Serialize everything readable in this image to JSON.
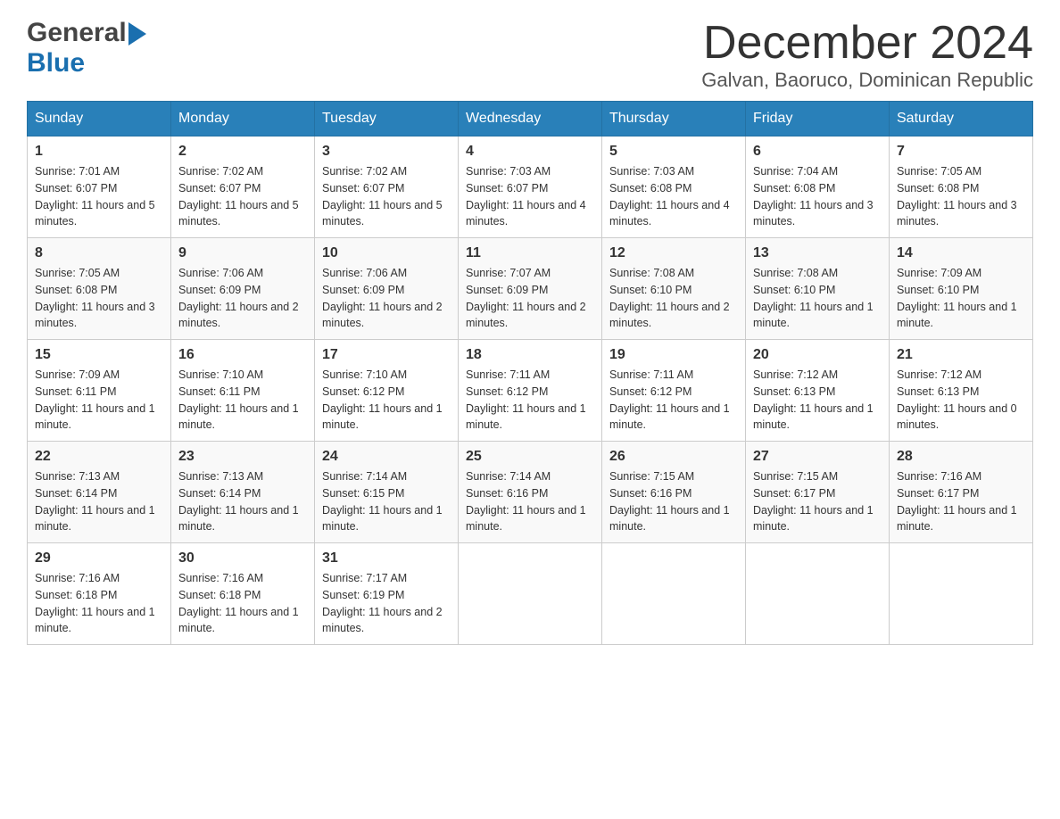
{
  "logo": {
    "general": "General",
    "blue": "Blue"
  },
  "title": "December 2024",
  "subtitle": "Galvan, Baoruco, Dominican Republic",
  "weekdays": [
    "Sunday",
    "Monday",
    "Tuesday",
    "Wednesday",
    "Thursday",
    "Friday",
    "Saturday"
  ],
  "weeks": [
    [
      {
        "day": "1",
        "sunrise": "7:01 AM",
        "sunset": "6:07 PM",
        "daylight": "11 hours and 5 minutes."
      },
      {
        "day": "2",
        "sunrise": "7:02 AM",
        "sunset": "6:07 PM",
        "daylight": "11 hours and 5 minutes."
      },
      {
        "day": "3",
        "sunrise": "7:02 AM",
        "sunset": "6:07 PM",
        "daylight": "11 hours and 5 minutes."
      },
      {
        "day": "4",
        "sunrise": "7:03 AM",
        "sunset": "6:07 PM",
        "daylight": "11 hours and 4 minutes."
      },
      {
        "day": "5",
        "sunrise": "7:03 AM",
        "sunset": "6:08 PM",
        "daylight": "11 hours and 4 minutes."
      },
      {
        "day": "6",
        "sunrise": "7:04 AM",
        "sunset": "6:08 PM",
        "daylight": "11 hours and 3 minutes."
      },
      {
        "day": "7",
        "sunrise": "7:05 AM",
        "sunset": "6:08 PM",
        "daylight": "11 hours and 3 minutes."
      }
    ],
    [
      {
        "day": "8",
        "sunrise": "7:05 AM",
        "sunset": "6:08 PM",
        "daylight": "11 hours and 3 minutes."
      },
      {
        "day": "9",
        "sunrise": "7:06 AM",
        "sunset": "6:09 PM",
        "daylight": "11 hours and 2 minutes."
      },
      {
        "day": "10",
        "sunrise": "7:06 AM",
        "sunset": "6:09 PM",
        "daylight": "11 hours and 2 minutes."
      },
      {
        "day": "11",
        "sunrise": "7:07 AM",
        "sunset": "6:09 PM",
        "daylight": "11 hours and 2 minutes."
      },
      {
        "day": "12",
        "sunrise": "7:08 AM",
        "sunset": "6:10 PM",
        "daylight": "11 hours and 2 minutes."
      },
      {
        "day": "13",
        "sunrise": "7:08 AM",
        "sunset": "6:10 PM",
        "daylight": "11 hours and 1 minute."
      },
      {
        "day": "14",
        "sunrise": "7:09 AM",
        "sunset": "6:10 PM",
        "daylight": "11 hours and 1 minute."
      }
    ],
    [
      {
        "day": "15",
        "sunrise": "7:09 AM",
        "sunset": "6:11 PM",
        "daylight": "11 hours and 1 minute."
      },
      {
        "day": "16",
        "sunrise": "7:10 AM",
        "sunset": "6:11 PM",
        "daylight": "11 hours and 1 minute."
      },
      {
        "day": "17",
        "sunrise": "7:10 AM",
        "sunset": "6:12 PM",
        "daylight": "11 hours and 1 minute."
      },
      {
        "day": "18",
        "sunrise": "7:11 AM",
        "sunset": "6:12 PM",
        "daylight": "11 hours and 1 minute."
      },
      {
        "day": "19",
        "sunrise": "7:11 AM",
        "sunset": "6:12 PM",
        "daylight": "11 hours and 1 minute."
      },
      {
        "day": "20",
        "sunrise": "7:12 AM",
        "sunset": "6:13 PM",
        "daylight": "11 hours and 1 minute."
      },
      {
        "day": "21",
        "sunrise": "7:12 AM",
        "sunset": "6:13 PM",
        "daylight": "11 hours and 0 minutes."
      }
    ],
    [
      {
        "day": "22",
        "sunrise": "7:13 AM",
        "sunset": "6:14 PM",
        "daylight": "11 hours and 1 minute."
      },
      {
        "day": "23",
        "sunrise": "7:13 AM",
        "sunset": "6:14 PM",
        "daylight": "11 hours and 1 minute."
      },
      {
        "day": "24",
        "sunrise": "7:14 AM",
        "sunset": "6:15 PM",
        "daylight": "11 hours and 1 minute."
      },
      {
        "day": "25",
        "sunrise": "7:14 AM",
        "sunset": "6:16 PM",
        "daylight": "11 hours and 1 minute."
      },
      {
        "day": "26",
        "sunrise": "7:15 AM",
        "sunset": "6:16 PM",
        "daylight": "11 hours and 1 minute."
      },
      {
        "day": "27",
        "sunrise": "7:15 AM",
        "sunset": "6:17 PM",
        "daylight": "11 hours and 1 minute."
      },
      {
        "day": "28",
        "sunrise": "7:16 AM",
        "sunset": "6:17 PM",
        "daylight": "11 hours and 1 minute."
      }
    ],
    [
      {
        "day": "29",
        "sunrise": "7:16 AM",
        "sunset": "6:18 PM",
        "daylight": "11 hours and 1 minute."
      },
      {
        "day": "30",
        "sunrise": "7:16 AM",
        "sunset": "6:18 PM",
        "daylight": "11 hours and 1 minute."
      },
      {
        "day": "31",
        "sunrise": "7:17 AM",
        "sunset": "6:19 PM",
        "daylight": "11 hours and 2 minutes."
      },
      null,
      null,
      null,
      null
    ]
  ]
}
